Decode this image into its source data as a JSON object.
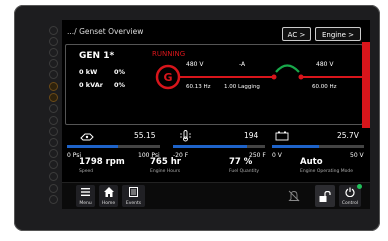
{
  "header": {
    "breadcrumb": ".../ Genset Overview",
    "ac_button": "AC >",
    "engine_button": "Engine >"
  },
  "genset": {
    "name": "GEN 1*",
    "kw": "0 kW",
    "kw_pct": "0%",
    "kvar": "0 kVAr",
    "kvar_pct": "0%",
    "state": "RUNNING",
    "gen_symbol": "G",
    "voltage_left": "480 V",
    "current": "-A",
    "freq_left": "60.13 Hz",
    "power_factor": "1.00 Lagging",
    "voltage_right": "480 V",
    "freq_right": "60.00 Hz",
    "colors": {
      "running": "#d8151b",
      "breaker": "#18a84a",
      "bus": "#d8151b"
    }
  },
  "gauges": [
    {
      "icon": "oil-pressure-icon",
      "value": "55.15",
      "min": "0 Psi",
      "max": "100 Psi",
      "level": 0.55
    },
    {
      "icon": "coolant-temp-icon",
      "value": "194",
      "min": "-20 F",
      "max": "250 F",
      "level": 0.8
    },
    {
      "icon": "battery-icon",
      "value": "25.7V",
      "min": "0 V",
      "max": "50 V",
      "level": 0.51
    }
  ],
  "stats": [
    {
      "value": "1798 rpm",
      "label": "Speed"
    },
    {
      "value": "765 hr",
      "label": "Engine Hours"
    },
    {
      "value": "77 %",
      "label": "Fuel Quantity"
    },
    {
      "value": "Auto",
      "label": "Engine Operating Mode"
    }
  ],
  "bottom": {
    "menu": "Menu",
    "home": "Home",
    "events": "Events",
    "control": "Control"
  }
}
